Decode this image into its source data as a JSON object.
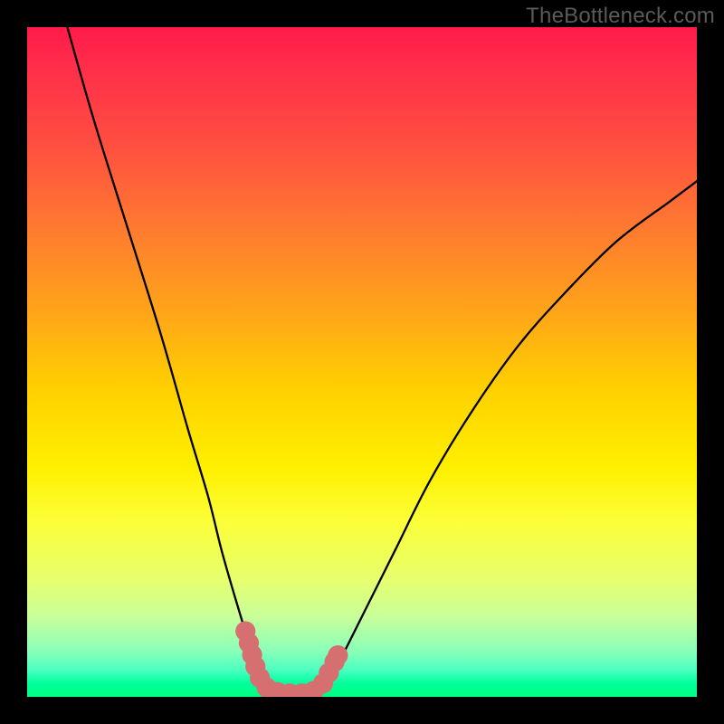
{
  "attribution": "TheBottleneck.com",
  "chart_data": {
    "type": "line",
    "title": "",
    "xlabel": "",
    "ylabel": "",
    "xlim": [
      0,
      100
    ],
    "ylim": [
      0,
      100
    ],
    "gradient_stops": [
      {
        "pct": 0,
        "color": "#ff1a4a"
      },
      {
        "pct": 6,
        "color": "#ff2e4a"
      },
      {
        "pct": 18,
        "color": "#ff5040"
      },
      {
        "pct": 30,
        "color": "#ff7a30"
      },
      {
        "pct": 42,
        "color": "#ffa31a"
      },
      {
        "pct": 54,
        "color": "#ffd000"
      },
      {
        "pct": 66,
        "color": "#fff000"
      },
      {
        "pct": 74,
        "color": "#fbff3a"
      },
      {
        "pct": 82,
        "color": "#e8ff6a"
      },
      {
        "pct": 88,
        "color": "#c8ff9a"
      },
      {
        "pct": 93,
        "color": "#8cffb8"
      },
      {
        "pct": 96,
        "color": "#4cffc0"
      },
      {
        "pct": 98,
        "color": "#00ff9c"
      },
      {
        "pct": 100,
        "color": "#00ff7c"
      }
    ],
    "series": [
      {
        "name": "left-curve",
        "x": [
          6,
          10,
          15,
          20,
          24,
          27,
          29,
          31,
          32.5,
          33.5,
          34.5,
          35.3
        ],
        "y": [
          100,
          86,
          70,
          54,
          40,
          30,
          22,
          15,
          10,
          7,
          4,
          1
        ]
      },
      {
        "name": "right-curve",
        "x": [
          44.5,
          46,
          48,
          51,
          55,
          60,
          66,
          73,
          80,
          88,
          96,
          100
        ],
        "y": [
          1,
          4,
          8,
          14,
          22,
          32,
          42,
          52,
          60,
          68,
          74,
          77
        ]
      },
      {
        "name": "valley-floor",
        "x": [
          35.3,
          36.5,
          38,
          40,
          42,
          43.5,
          44.5
        ],
        "y": [
          1,
          0.4,
          0.1,
          0,
          0.1,
          0.4,
          1
        ]
      }
    ],
    "valley_markers": {
      "color": "#d67070",
      "points": [
        {
          "x": 32.6,
          "y": 9.8
        },
        {
          "x": 33.4,
          "y": 7.0
        },
        {
          "x": 34.0,
          "y": 4.8
        },
        {
          "x": 34.6,
          "y": 3.2
        },
        {
          "x": 35.2,
          "y": 2.0
        },
        {
          "x": 36.0,
          "y": 1.2
        },
        {
          "x": 37.0,
          "y": 0.8
        },
        {
          "x": 38.2,
          "y": 0.6
        },
        {
          "x": 39.5,
          "y": 0.5
        },
        {
          "x": 40.8,
          "y": 0.5
        },
        {
          "x": 42.0,
          "y": 0.6
        },
        {
          "x": 43.0,
          "y": 1.0
        },
        {
          "x": 43.8,
          "y": 1.6
        },
        {
          "x": 44.4,
          "y": 2.4
        },
        {
          "x": 46.4,
          "y": 6.2
        }
      ],
      "radius": 1.5
    }
  }
}
